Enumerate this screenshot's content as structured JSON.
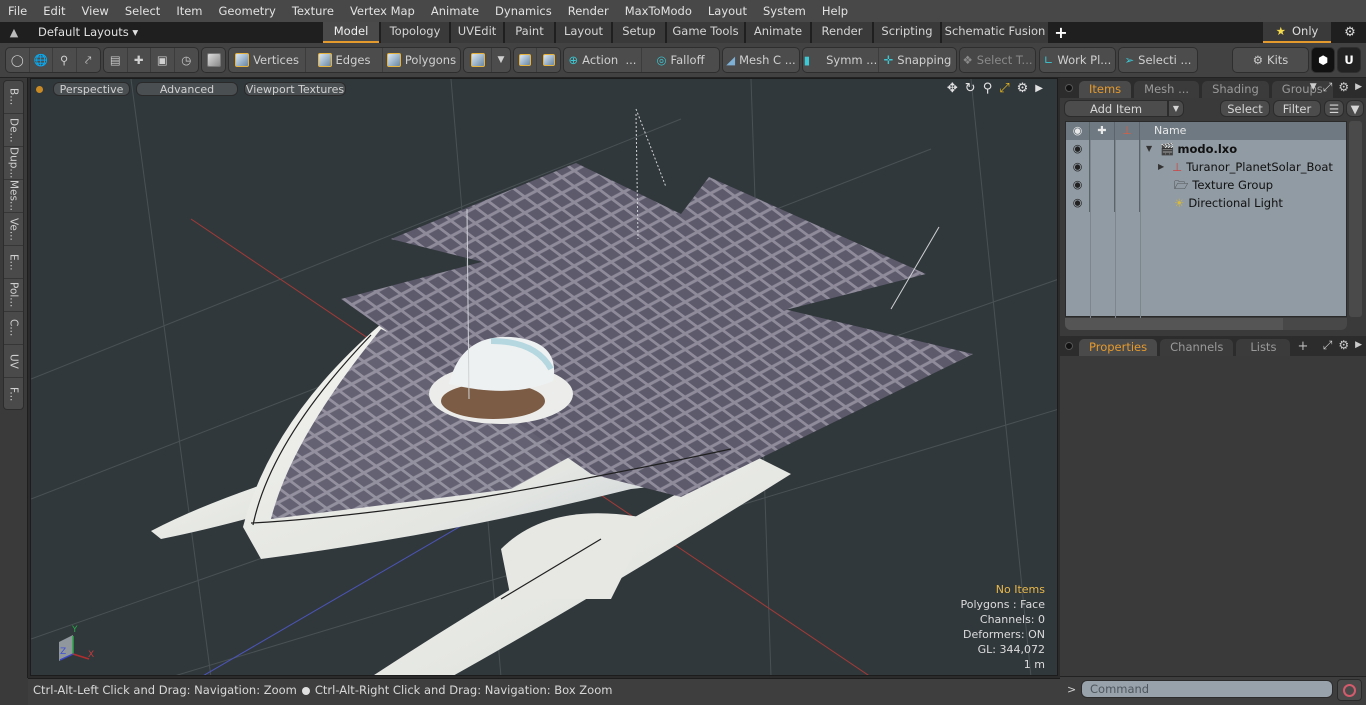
{
  "menu": [
    "File",
    "Edit",
    "View",
    "Select",
    "Item",
    "Geometry",
    "Texture",
    "Vertex Map",
    "Animate",
    "Dynamics",
    "Render",
    "MaxToModo",
    "Layout",
    "System",
    "Help"
  ],
  "layout_bar": {
    "layouts_dropdown": "Default Layouts ▾",
    "tabs": [
      "Model",
      "Topology",
      "UVEdit",
      "Paint",
      "Layout",
      "Setup",
      "Game Tools",
      "Animate",
      "Render",
      "Scripting",
      "Schematic Fusion"
    ],
    "active_tab": "Model",
    "add_tab": "+",
    "only_label": "Only",
    "star": "★",
    "gear": "⚙"
  },
  "toolbar": {
    "vertices": "Vertices",
    "edges": "Edges",
    "polygons": "Polygons",
    "action": "Action",
    "action_more": "...",
    "falloff": "Falloff",
    "mesh_c": "Mesh C ...",
    "symm": "Symm ...",
    "snapping": "Snapping",
    "select_t": "Select T...",
    "work_pl": "Work Pl...",
    "selecti": "Selecti ...",
    "kits": "Kits"
  },
  "left_tabs": [
    "B...",
    "De...",
    "Dup...",
    "Mes...",
    "Ve...",
    "E...",
    "Pol...",
    "C...",
    "UV",
    "F..."
  ],
  "viewport": {
    "view_mode": "Perspective",
    "shading": "Advanced",
    "textures": "Viewport Textures",
    "stats": {
      "selection": "No Items",
      "polygons": "Polygons : Face",
      "channels": "Channels: 0",
      "deformers": "Deformers: ON",
      "gl": "GL: 344,072",
      "scale": "1 m"
    },
    "axis_labels": {
      "x": "X",
      "y": "Y",
      "z": "Z"
    }
  },
  "status_bar": {
    "hint_left": "Ctrl-Alt-Left Click and Drag: Navigation: Zoom",
    "hint_right": "Ctrl-Alt-Right Click and Drag: Navigation: Box Zoom"
  },
  "items_panel": {
    "tabs": [
      "Items",
      "Mesh ...",
      "Shading",
      "Groups"
    ],
    "active_tab": "Items",
    "add_item": "Add Item",
    "select": "Select",
    "filter": "Filter",
    "column_name": "Name",
    "tree": [
      {
        "name": "modo.lxo",
        "level": 0,
        "expander": "▼",
        "bold": true,
        "icon": "scene-icon"
      },
      {
        "name": "Turanor_PlanetSolar_Boat",
        "level": 1,
        "expander": "▶",
        "bold": false,
        "icon": "mesh-locator-icon"
      },
      {
        "name": "Texture Group",
        "level": 1,
        "expander": "",
        "bold": false,
        "icon": "texture-group-icon"
      },
      {
        "name": "Directional Light",
        "level": 1,
        "expander": "",
        "bold": false,
        "icon": "directional-light-icon"
      }
    ]
  },
  "properties_panel": {
    "tabs": [
      "Properties",
      "Channels",
      "Lists"
    ],
    "active_tab": "Properties",
    "add_tab": "+"
  },
  "command": {
    "prompt": ">",
    "placeholder": "Command"
  },
  "colors": {
    "accent": "#e59a2d",
    "viewport_bg": "#31383c",
    "list_bg": "#919ba3",
    "stats_warning": "#e8b84a"
  }
}
